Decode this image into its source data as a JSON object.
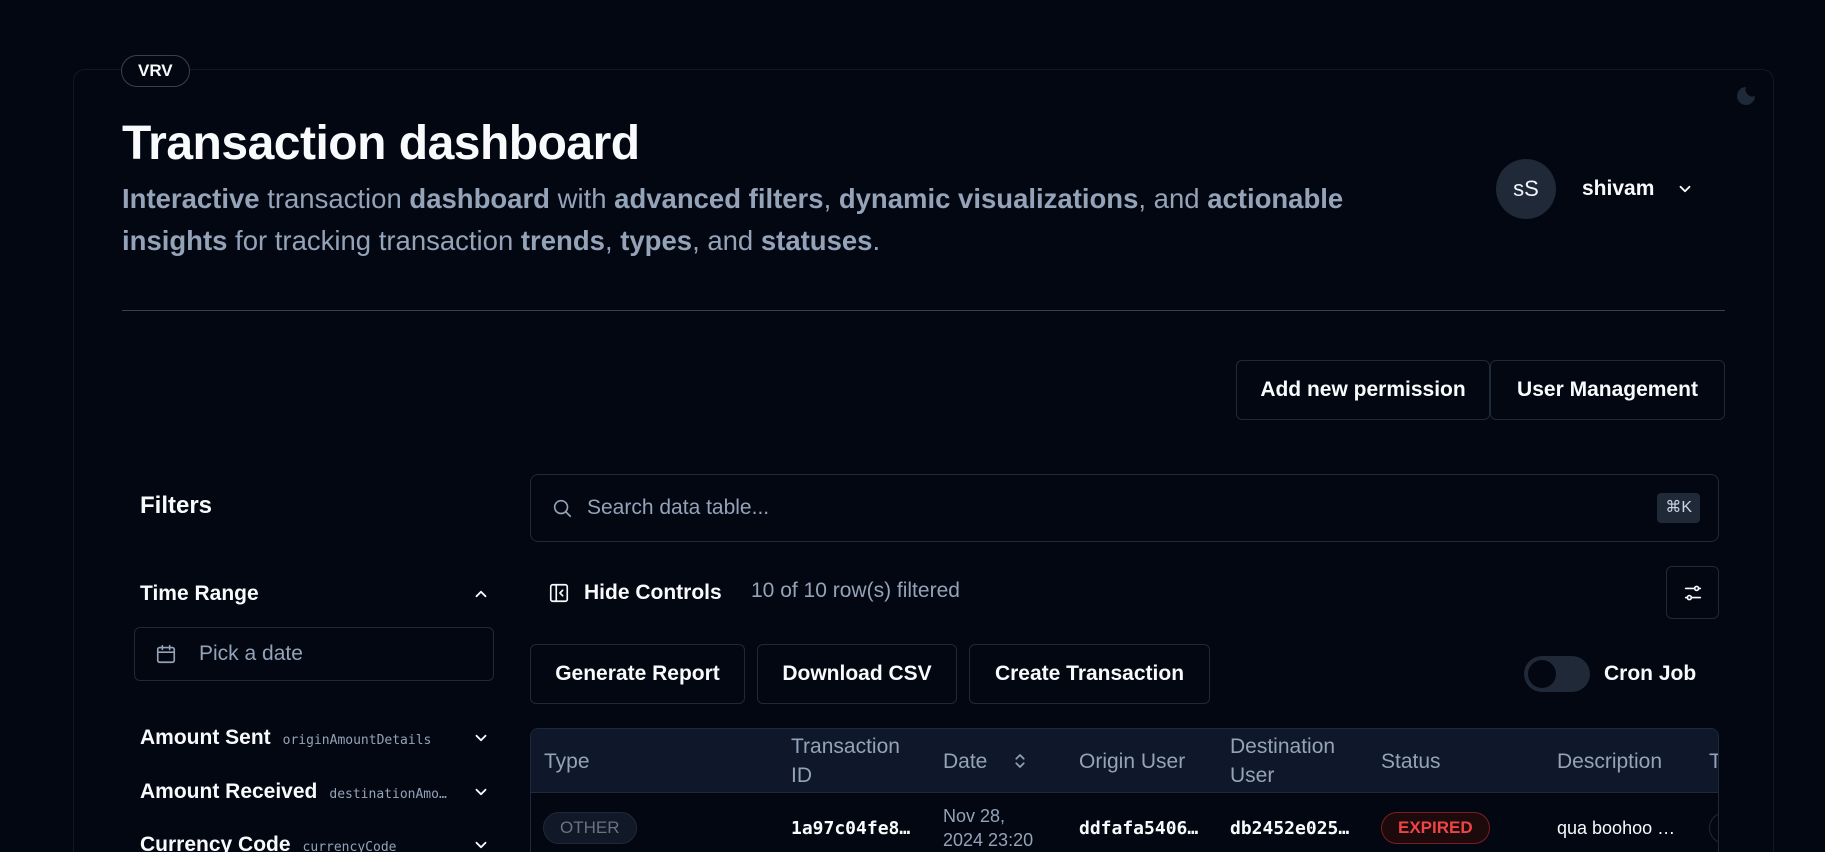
{
  "brand": {
    "badge": "VRV"
  },
  "header": {
    "title": "Transaction dashboard",
    "subtitle_parts": [
      {
        "text": "Interactive",
        "bold": true
      },
      {
        "text": " transaction ",
        "bold": false
      },
      {
        "text": "dashboard",
        "bold": true
      },
      {
        "text": " with ",
        "bold": false
      },
      {
        "text": "advanced filters",
        "bold": true
      },
      {
        "text": ", ",
        "bold": false
      },
      {
        "text": "dynamic visualizations",
        "bold": true
      },
      {
        "text": ", and ",
        "bold": false
      },
      {
        "text": "actionable insights",
        "bold": true
      },
      {
        "text": " for tracking transaction ",
        "bold": false
      },
      {
        "text": "trends",
        "bold": true
      },
      {
        "text": ", ",
        "bold": false
      },
      {
        "text": "types",
        "bold": true
      },
      {
        "text": ", and ",
        "bold": false
      },
      {
        "text": "statuses",
        "bold": true
      },
      {
        "text": ".",
        "bold": false
      }
    ]
  },
  "user": {
    "initials": "sS",
    "name": "shivam"
  },
  "actions": {
    "add_permission": "Add new permission",
    "user_management": "User Management"
  },
  "filters": {
    "title": "Filters",
    "time_range": {
      "label": "Time Range",
      "placeholder": "Pick a date"
    },
    "amount_sent": {
      "label": "Amount Sent",
      "key": "originAmountDetails"
    },
    "amount_received": {
      "label": "Amount Received",
      "key": "destinationAmo…"
    },
    "currency_code": {
      "label": "Currency Code",
      "key": "currencyCode"
    }
  },
  "table_controls": {
    "search_placeholder": "Search data table...",
    "shortcut": "⌘K",
    "hide_controls": "Hide Controls",
    "row_count": "10 of 10 row(s) filtered",
    "generate_report": "Generate Report",
    "download_csv": "Download CSV",
    "create_transaction": "Create Transaction",
    "cron_job": "Cron Job"
  },
  "table": {
    "columns": {
      "type": "Type",
      "transaction_id": "Transaction ID",
      "date": "Date",
      "origin_user": "Origin User",
      "destination_user": "Destination User",
      "status": "Status",
      "description": "Description",
      "next": "T"
    },
    "rows": [
      {
        "type": "OTHER",
        "transaction_id": "1a97c04fe8…",
        "date_line1": "Nov 28,",
        "date_line2": "2024 23:20",
        "origin_user": "ddfafa5406…",
        "destination_user": "db2452e025…",
        "status": "EXPIRED",
        "description": "qua boohoo …"
      }
    ]
  }
}
